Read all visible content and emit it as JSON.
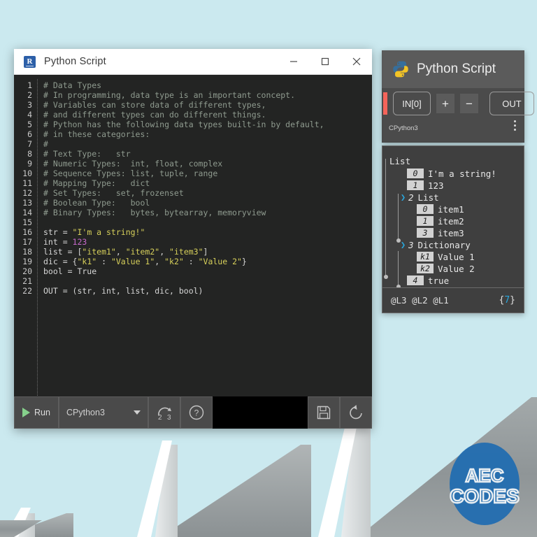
{
  "background": {
    "sky_color": "#cbe9ef",
    "roof_color": "#949a9b",
    "logo": {
      "name": "AEC CODES",
      "line1": "AEC",
      "line2": "CODES",
      "color": "#1f6cb0"
    }
  },
  "editor_window": {
    "title": "Python Script",
    "app_icon": "revit-icon",
    "icon_letter": "R",
    "window_controls": [
      {
        "name": "minimize",
        "glyph": "minimize-icon"
      },
      {
        "name": "maximize",
        "glyph": "maximize-icon"
      },
      {
        "name": "close",
        "glyph": "close-icon"
      }
    ],
    "code": {
      "lines": [
        {
          "n": "1",
          "segments": [
            {
              "t": "# Data Types",
              "c": "cmt"
            }
          ]
        },
        {
          "n": "2",
          "segments": [
            {
              "t": "# In programming, data type is an important concept.",
              "c": "cmt"
            }
          ]
        },
        {
          "n": "3",
          "segments": [
            {
              "t": "# Variables can store data of different types,",
              "c": "cmt"
            }
          ]
        },
        {
          "n": "4",
          "segments": [
            {
              "t": "# and different types can do different things.",
              "c": "cmt"
            }
          ]
        },
        {
          "n": "5",
          "segments": [
            {
              "t": "# Python has the following data types built-in by default,",
              "c": "cmt"
            }
          ]
        },
        {
          "n": "6",
          "segments": [
            {
              "t": "# in these categories:",
              "c": "cmt"
            }
          ]
        },
        {
          "n": "7",
          "segments": [
            {
              "t": "#",
              "c": "cmt"
            }
          ]
        },
        {
          "n": "8",
          "segments": [
            {
              "t": "# Text Type:   str",
              "c": "cmt"
            }
          ]
        },
        {
          "n": "9",
          "segments": [
            {
              "t": "# Numeric Types:  int, float, complex",
              "c": "cmt"
            }
          ]
        },
        {
          "n": "10",
          "segments": [
            {
              "t": "# Sequence Types: list, tuple, range",
              "c": "cmt"
            }
          ]
        },
        {
          "n": "11",
          "segments": [
            {
              "t": "# Mapping Type:   dict",
              "c": "cmt"
            }
          ]
        },
        {
          "n": "12",
          "segments": [
            {
              "t": "# Set Types:   set, frozenset",
              "c": "cmt"
            }
          ]
        },
        {
          "n": "13",
          "segments": [
            {
              "t": "# Boolean Type:   bool",
              "c": "cmt"
            }
          ]
        },
        {
          "n": "14",
          "segments": [
            {
              "t": "# Binary Types:   bytes, bytearray, memoryview",
              "c": "cmt"
            }
          ]
        },
        {
          "n": "15",
          "segments": [
            {
              "t": "",
              "c": ""
            }
          ]
        },
        {
          "n": "16",
          "segments": [
            {
              "t": "str = ",
              "c": ""
            },
            {
              "t": "\"I'm a string!\"",
              "c": "str"
            }
          ]
        },
        {
          "n": "17",
          "segments": [
            {
              "t": "int = ",
              "c": ""
            },
            {
              "t": "123",
              "c": "num"
            }
          ]
        },
        {
          "n": "18",
          "segments": [
            {
              "t": "list = [",
              "c": ""
            },
            {
              "t": "\"item1\"",
              "c": "str"
            },
            {
              "t": ", ",
              "c": ""
            },
            {
              "t": "\"item2\"",
              "c": "str"
            },
            {
              "t": ", ",
              "c": ""
            },
            {
              "t": "\"item3\"",
              "c": "str"
            },
            {
              "t": "]",
              "c": ""
            }
          ]
        },
        {
          "n": "19",
          "segments": [
            {
              "t": "dic = {",
              "c": ""
            },
            {
              "t": "\"k1\"",
              "c": "str"
            },
            {
              "t": " : ",
              "c": ""
            },
            {
              "t": "\"Value 1\"",
              "c": "str"
            },
            {
              "t": ", ",
              "c": ""
            },
            {
              "t": "\"k2\"",
              "c": "str"
            },
            {
              "t": " : ",
              "c": ""
            },
            {
              "t": "\"Value 2\"",
              "c": "str"
            },
            {
              "t": "}",
              "c": ""
            }
          ]
        },
        {
          "n": "20",
          "segments": [
            {
              "t": "bool = True",
              "c": ""
            }
          ]
        },
        {
          "n": "21",
          "segments": [
            {
              "t": "",
              "c": ""
            }
          ]
        },
        {
          "n": "22",
          "segments": [
            {
              "t": "OUT = (str, int, list, dic, bool)",
              "c": ""
            }
          ]
        }
      ]
    },
    "toolbar": {
      "run_label": "Run",
      "engine_value": "CPython3",
      "migrate_icon": "python2-to-3-migrate-icon",
      "migrate_from": "2",
      "migrate_to": "3",
      "help_icon": "help-question-icon",
      "save_icon": "save-floppy-icon",
      "revert_icon": "revert-undo-icon"
    }
  },
  "node": {
    "title": "Python Script",
    "icon": "python-logo-icon",
    "in_port": "IN[0]",
    "add_button": "+",
    "remove_button": "−",
    "out_port": "OUT",
    "engine": "CPython3",
    "menu_icon": "kebab-menu-icon",
    "accent_warning_color": "#f4645a"
  },
  "watch": {
    "root_label": "List",
    "rows": [
      {
        "indent": 1,
        "caret": false,
        "idx": "0",
        "value": "I'm a string!",
        "type": "value"
      },
      {
        "indent": 1,
        "caret": false,
        "idx": "1",
        "value": "123",
        "type": "value"
      },
      {
        "indent": 1,
        "caret": true,
        "idx": "2",
        "value": "List",
        "type": "group"
      },
      {
        "indent": 2,
        "caret": false,
        "idx": "0",
        "value": "item1",
        "type": "value"
      },
      {
        "indent": 2,
        "caret": false,
        "idx": "1",
        "value": "item2",
        "type": "value"
      },
      {
        "indent": 2,
        "caret": false,
        "idx": "3",
        "value": "item3",
        "type": "value"
      },
      {
        "indent": 1,
        "caret": true,
        "idx": "3",
        "value": "Dictionary",
        "type": "group"
      },
      {
        "indent": 2,
        "caret": false,
        "idx": "k1",
        "value": "Value 1",
        "type": "value"
      },
      {
        "indent": 2,
        "caret": false,
        "idx": "k2",
        "value": "Value 2",
        "type": "value"
      },
      {
        "indent": 1,
        "caret": false,
        "idx": "4",
        "value": "true",
        "type": "value"
      }
    ],
    "status_levels": "@L3 @L2 @L1",
    "status_count_prefix": "{",
    "status_count": "7",
    "status_count_suffix": "}"
  }
}
